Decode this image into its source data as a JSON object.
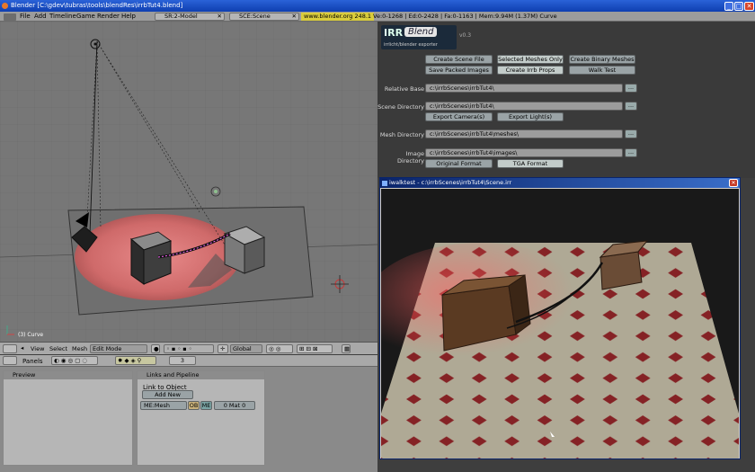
{
  "window": {
    "title": "Blender [C:\\gdev\\tubras\\tools\\blendRes\\irrbTut4.blend]"
  },
  "menubar": {
    "items": [
      "File",
      "Add",
      "Timeline",
      "Game",
      "Render",
      "Help"
    ],
    "screen": "SR:2-Model",
    "scene": "SCE:Scene",
    "weblink": "www.blender.org 248.1",
    "stats": "Ve:0-1268 | Ed:0-2428 | Fa:0-1163 | Mem:9.94M (1.37M) Curve"
  },
  "viewport": {
    "object_label": "(3) Curve"
  },
  "viewport_header": {
    "view": "View",
    "select": "Select",
    "mesh": "Mesh",
    "mode": "Edit Mode",
    "orientation": "Global"
  },
  "buttons_header": {
    "panels": "Panels",
    "frame": "3"
  },
  "panels": {
    "preview_title": "Preview",
    "links_title": "Links and Pipeline",
    "link_to_object": "Link to Object",
    "add_new": "Add New",
    "mesh_name": "ME:Mesh",
    "ob": "OB",
    "me": "ME",
    "mat": "0 Mat 0"
  },
  "exporter": {
    "logo_text": "IRR",
    "logo_blend": "Blend",
    "logo_sub": "irrlicht/blender exporter",
    "version": "v0.3",
    "buttons": {
      "create_scene_file": "Create Scene File",
      "selected_meshes_only": "Selected Meshes Only",
      "create_binary_meshes": "Create Binary Meshes",
      "save_packed_images": "Save Packed Images",
      "create_irrb_props": "Create Irrb Props",
      "walk_test": "Walk Test",
      "export_cameras": "Export Camera(s)",
      "export_lights": "Export Light(s)",
      "original_format": "Original Format",
      "tga_format": "TGA Format"
    },
    "labels": {
      "relative_base": "Relative Base",
      "scene_directory": "Scene Directory",
      "mesh_directory": "Mesh Directory",
      "image_directory": "Image Directory"
    },
    "paths": {
      "relative_base": "c:\\irrbScenes\\irrbTut4\\",
      "scene_directory": "c:\\irrbScenes\\irrbTut4\\",
      "mesh_directory": "c:\\irrbScenes\\irrbTut4\\meshes\\",
      "image_directory": "c:\\irrbScenes\\irrbTut4\\images\\"
    },
    "browse": "..."
  },
  "irr_window": {
    "title": "iwalktest - c:\\irrbScenes\\irrbTut4\\Scene.irr",
    "close": "✕"
  },
  "colors": {
    "title_blue": "#0f3fb0",
    "floor_red": "#a82a2a",
    "tile_cream": "#d8d2b8",
    "spot_red": "#d87070"
  }
}
